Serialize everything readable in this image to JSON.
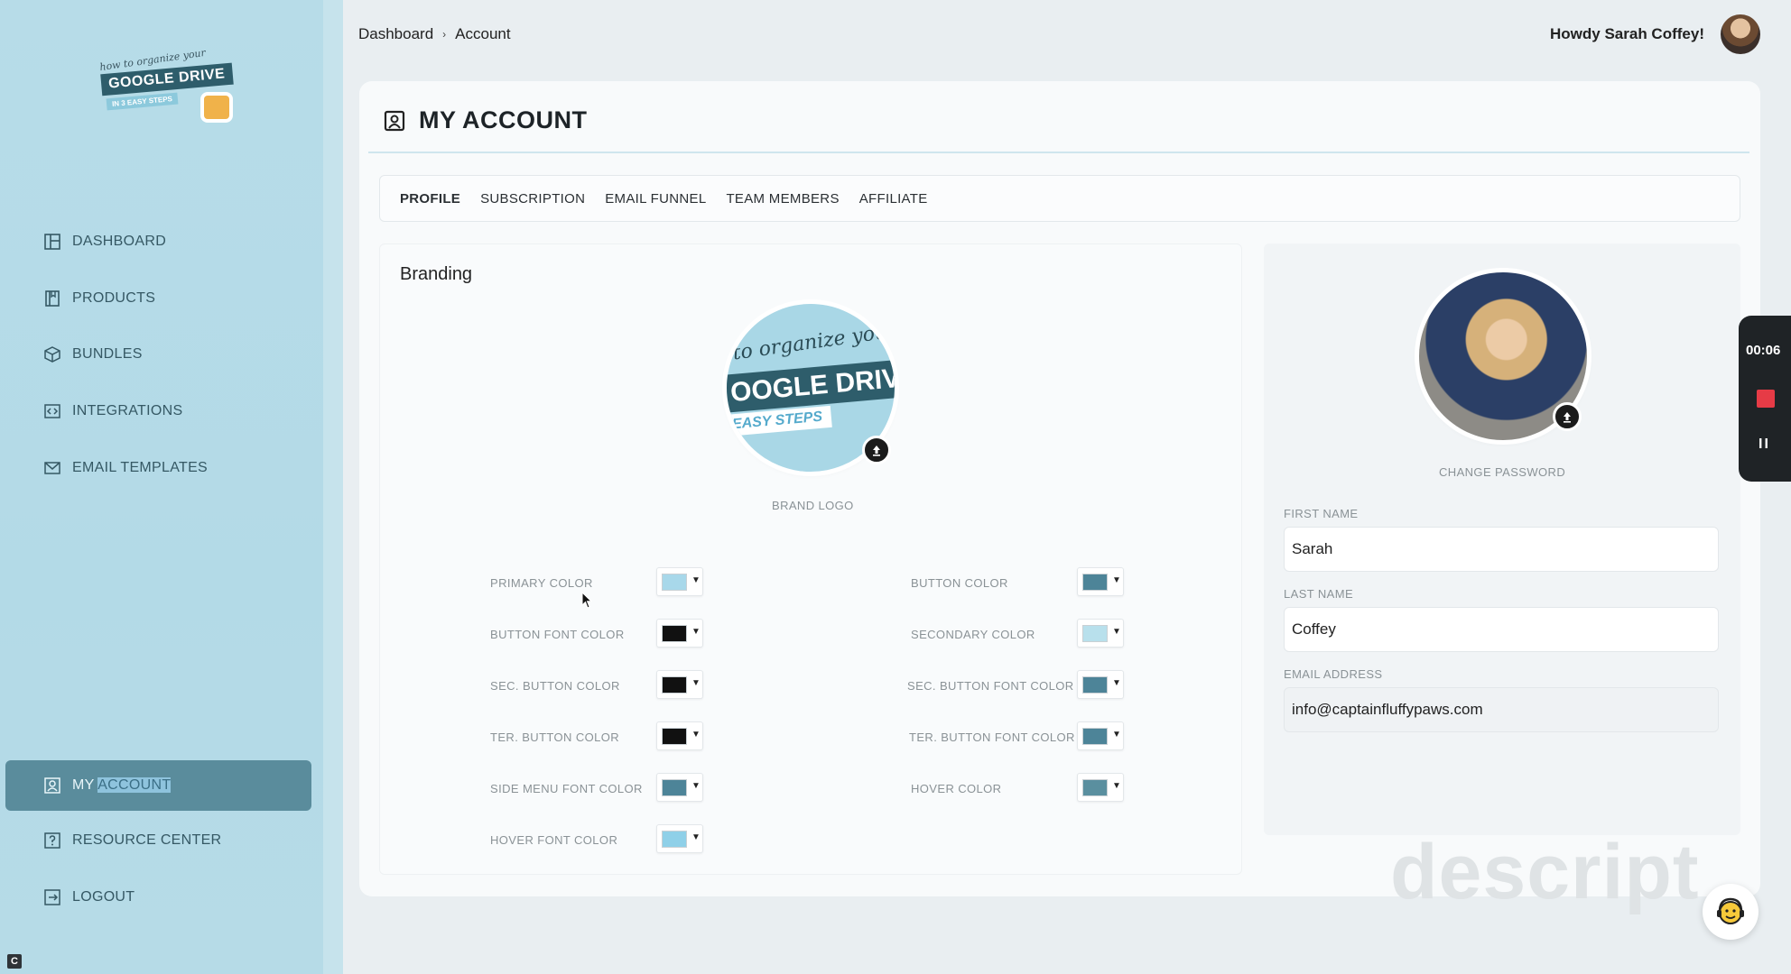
{
  "brand": {
    "logo_script": "how to organize your",
    "logo_main": "GOOGLE DRIVE",
    "logo_sub": "IN 3 EASY STEPS"
  },
  "sidebar": {
    "items": [
      {
        "label": "DASHBOARD",
        "icon": "dashboard-icon"
      },
      {
        "label": "PRODUCTS",
        "icon": "book-icon"
      },
      {
        "label": "BUNDLES",
        "icon": "box-icon"
      },
      {
        "label": "INTEGRATIONS",
        "icon": "code-icon"
      },
      {
        "label": "EMAIL TEMPLATES",
        "icon": "mail-icon"
      },
      {
        "label_prefix": "MY ",
        "label_selected": "ACCOUNT",
        "icon": "account-icon",
        "active": true
      },
      {
        "label": "RESOURCE CENTER",
        "icon": "help-icon"
      },
      {
        "label": "LOGOUT",
        "icon": "logout-icon"
      }
    ]
  },
  "breadcrumb": {
    "root": "Dashboard",
    "separator": "›",
    "current": "Account"
  },
  "header": {
    "greeting": "Howdy Sarah Coffey!"
  },
  "page": {
    "title": "MY ACCOUNT"
  },
  "tabs": [
    {
      "label": "PROFILE",
      "active": true
    },
    {
      "label": "SUBSCRIPTION"
    },
    {
      "label": "EMAIL FUNNEL"
    },
    {
      "label": "TEAM MEMBERS"
    },
    {
      "label": "AFFILIATE"
    }
  ],
  "branding": {
    "title": "Branding",
    "logo_caption": "BRAND LOGO",
    "logo_script": "to organize your",
    "logo_main": "OOGLE DRIV",
    "logo_sub": "EASY STEPS",
    "colors_left": [
      {
        "label": "PRIMARY COLOR",
        "color": "#a8d8ea"
      },
      {
        "label": "BUTTON FONT COLOR",
        "color": "#111111"
      },
      {
        "label": "SEC. BUTTON COLOR",
        "color": "#111111"
      },
      {
        "label": "TER. BUTTON COLOR",
        "color": "#111111"
      },
      {
        "label": "SIDE MENU FONT COLOR",
        "color": "#4d8498"
      },
      {
        "label": "HOVER FONT COLOR",
        "color": "#8fd0e8"
      }
    ],
    "colors_right": [
      {
        "label": "BUTTON COLOR",
        "color": "#4d8498"
      },
      {
        "label": "SECONDARY COLOR",
        "color": "#b8e0ec"
      },
      {
        "label": "SEC. BUTTON FONT COLOR",
        "color": "#4d8498"
      },
      {
        "label": "TER. BUTTON FONT COLOR",
        "color": "#4d8498"
      },
      {
        "label": "HOVER COLOR",
        "color": "#5a8f9f"
      }
    ]
  },
  "profile": {
    "change_password": "CHANGE PASSWORD",
    "first_name_label": "FIRST NAME",
    "first_name": "Sarah",
    "last_name_label": "LAST NAME",
    "last_name": "Coffey",
    "email_label": "EMAIL ADDRESS",
    "email": "info@captainfluffypaws.com"
  },
  "recorder": {
    "time": "00:06"
  },
  "watermark": "descript",
  "corner_badge": "C"
}
